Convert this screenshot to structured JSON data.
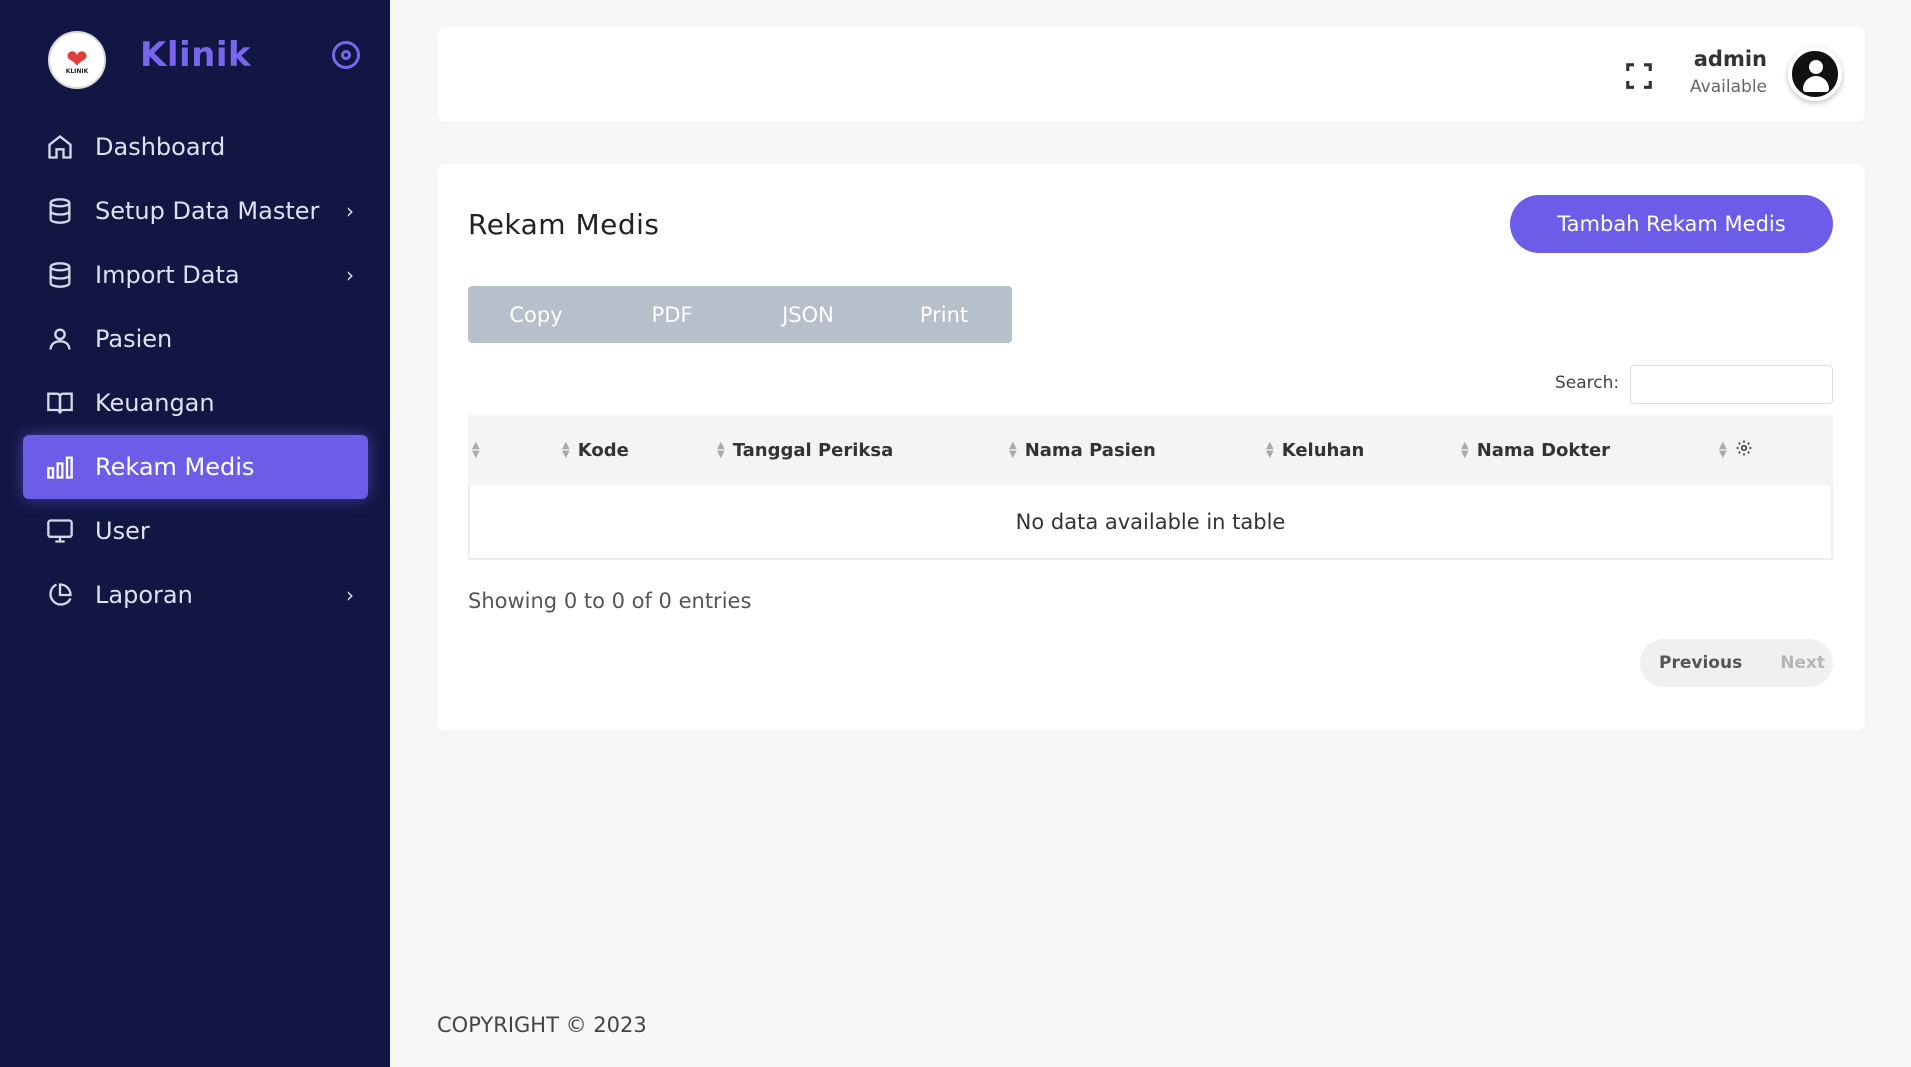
{
  "brand": {
    "title": "Klinik",
    "logo_text": "KLINIK"
  },
  "nav": [
    {
      "label": "Dashboard",
      "icon": "home-icon",
      "has_children": false,
      "active": false
    },
    {
      "label": "Setup Data Master",
      "icon": "database-icon",
      "has_children": true,
      "active": false
    },
    {
      "label": "Import Data",
      "icon": "database-icon",
      "has_children": true,
      "active": false
    },
    {
      "label": "Pasien",
      "icon": "user-icon",
      "has_children": false,
      "active": false
    },
    {
      "label": "Keuangan",
      "icon": "book-open-icon",
      "has_children": false,
      "active": false
    },
    {
      "label": "Rekam Medis",
      "icon": "bar-chart-icon",
      "has_children": false,
      "active": true
    },
    {
      "label": "User",
      "icon": "monitor-icon",
      "has_children": false,
      "active": false
    },
    {
      "label": "Laporan",
      "icon": "pie-chart-icon",
      "has_children": true,
      "active": false
    }
  ],
  "header": {
    "user_name": "admin",
    "user_status": "Available"
  },
  "main": {
    "title": "Rekam Medis",
    "add_button": "Tambah Rekam Medis",
    "export_buttons": [
      "Copy",
      "PDF",
      "JSON",
      "Print"
    ],
    "search_label": "Search:",
    "search_value": "",
    "columns": [
      "",
      "Kode",
      "Tanggal Periksa",
      "Nama Pasien",
      "Keluhan",
      "Nama Dokter",
      ""
    ],
    "empty_message": "No data available in table",
    "info": "Showing 0 to 0 of 0 entries",
    "pagination": {
      "previous": "Previous",
      "next": "Next"
    }
  },
  "footer": {
    "copyright": "COPYRIGHT © 2023"
  },
  "colors": {
    "sidebar_bg": "#111642",
    "accent": "#6d5ce8",
    "export_bg": "#b7bfcb"
  }
}
